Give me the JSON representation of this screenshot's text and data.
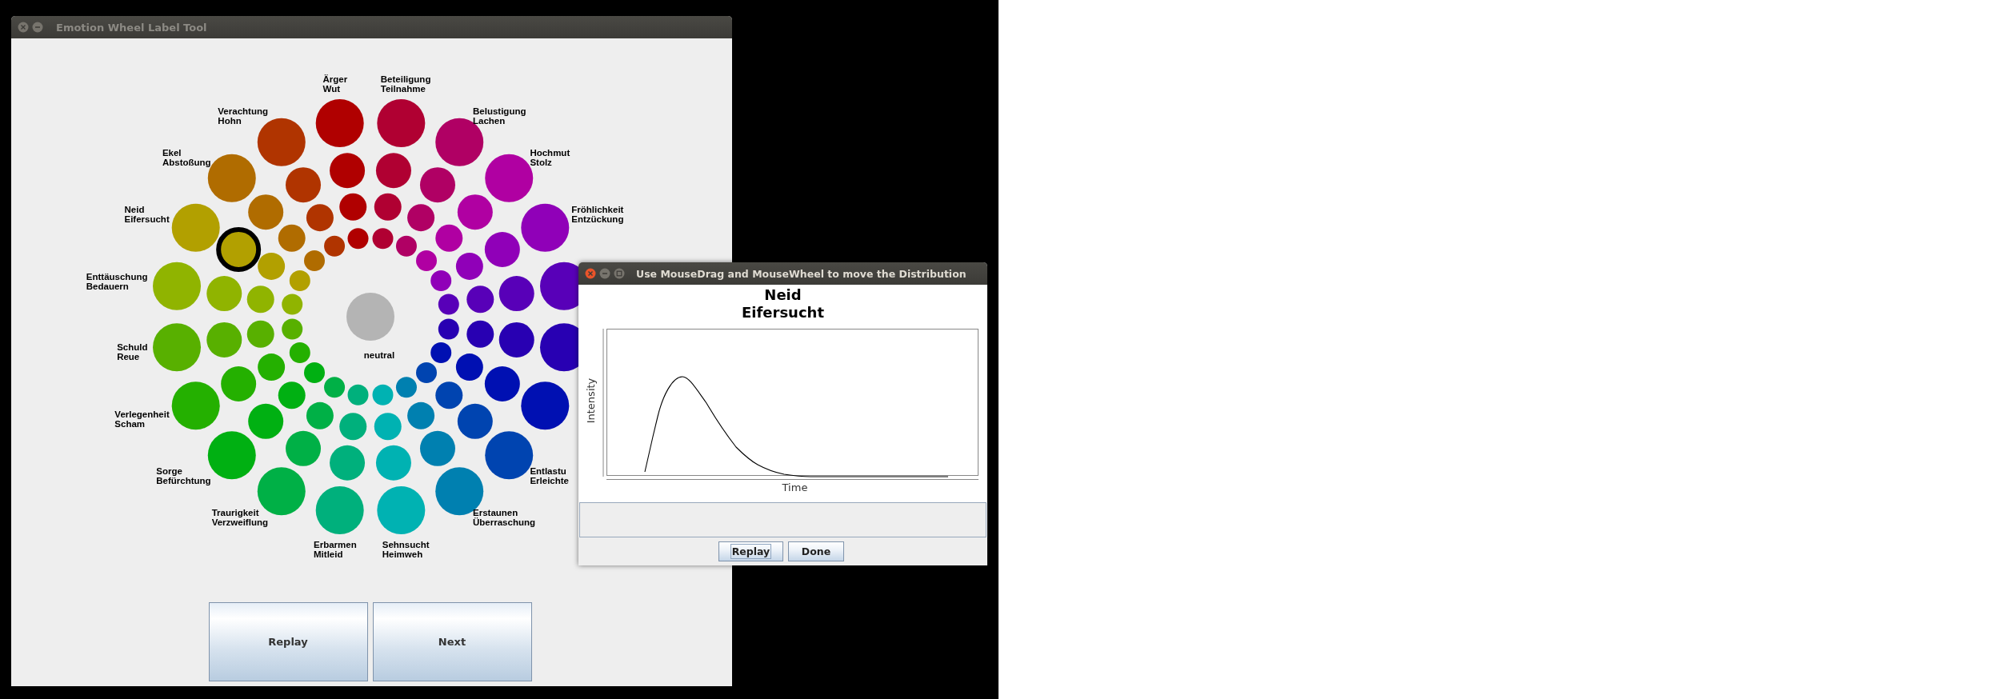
{
  "window": {
    "title": "Emotion Wheel Label Tool",
    "active": false
  },
  "wheel": {
    "center_label": "neutral",
    "upper_spokes": [
      {
        "label": "Enttäuschung\nBedauern",
        "color": "#90b400",
        "circles": [
          {
            "selected": false
          },
          {
            "selected": false
          },
          {
            "selected": false
          },
          {
            "selected": false
          }
        ]
      },
      {
        "label": "Neid\nEifersucht",
        "color": "#b2a000",
        "circles": [
          {
            "selected": false
          },
          {
            "selected": false
          },
          {
            "selected": true
          },
          {
            "selected": false
          }
        ]
      },
      {
        "label": "Ekel\nAbstoßung",
        "color": "#b06c00",
        "circles": [
          {
            "selected": false
          },
          {
            "selected": false
          },
          {
            "selected": false
          },
          {
            "selected": false
          }
        ]
      },
      {
        "label": "Verachtung\nHohn",
        "color": "#b03400",
        "circles": [
          {
            "selected": false
          },
          {
            "selected": false
          },
          {
            "selected": false
          },
          {
            "selected": false
          }
        ]
      },
      {
        "label": "Ärger\nWut",
        "color": "#b00000",
        "circles": [
          {
            "selected": false
          },
          {
            "selected": false
          },
          {
            "selected": false
          },
          {
            "selected": false
          }
        ]
      },
      {
        "label": "Beteiligung\nTeilnahme",
        "color": "#b00032",
        "circles": [
          {
            "selected": false
          },
          {
            "selected": false
          },
          {
            "selected": false
          },
          {
            "selected": false
          }
        ]
      },
      {
        "label": "Belustigung\nLachen",
        "color": "#b00064",
        "circles": [
          {
            "selected": false
          },
          {
            "selected": false
          },
          {
            "selected": false
          },
          {
            "selected": false
          }
        ]
      },
      {
        "label": "Hochmut\nStolz",
        "color": "#b000a2",
        "circles": [
          {
            "selected": false
          },
          {
            "selected": false
          },
          {
            "selected": false
          },
          {
            "selected": false
          }
        ]
      },
      {
        "label": "Fröhlichkeit\nEntzückung",
        "color": "#9000b8",
        "circles": [
          {
            "selected": false
          },
          {
            "selected": false
          },
          {
            "selected": false
          },
          {
            "selected": false
          }
        ]
      },
      {
        "color": "#5800b8",
        "circles": [
          {
            "selected": false
          },
          {
            "selected": false
          },
          {
            "selected": false
          },
          {
            "selected": false
          }
        ]
      }
    ],
    "lower_spokes": [
      {
        "label": "Schuld\nReue",
        "color": "#58b000",
        "circles": [
          {
            "selected": false
          },
          {
            "selected": false
          },
          {
            "selected": false
          },
          {
            "selected": false
          }
        ]
      },
      {
        "label": "Verlegenheit\nScham",
        "color": "#24b000",
        "circles": [
          {
            "selected": false
          },
          {
            "selected": false
          },
          {
            "selected": false
          },
          {
            "selected": false
          }
        ]
      },
      {
        "label": "Sorge\nBefürchtung",
        "color": "#00b012",
        "circles": [
          {
            "selected": false
          },
          {
            "selected": false
          },
          {
            "selected": false
          },
          {
            "selected": false
          }
        ]
      },
      {
        "label": "Traurigkeit\nVerzweiflung",
        "color": "#00b046",
        "circles": [
          {
            "selected": false
          },
          {
            "selected": false
          },
          {
            "selected": false
          },
          {
            "selected": false
          }
        ]
      },
      {
        "label": "Erbarmen\nMitleid",
        "color": "#00b07c",
        "circles": [
          {
            "selected": false
          },
          {
            "selected": false
          },
          {
            "selected": false
          },
          {
            "selected": false
          }
        ]
      },
      {
        "label": "Sehnsucht\nHeimweh",
        "color": "#00b2b2",
        "circles": [
          {
            "selected": false
          },
          {
            "selected": false
          },
          {
            "selected": false
          },
          {
            "selected": false
          }
        ]
      },
      {
        "label": "Erstaunen\nÜberraschung",
        "color": "#0080b0",
        "circles": [
          {
            "selected": false
          },
          {
            "selected": false
          },
          {
            "selected": false
          },
          {
            "selected": false
          }
        ]
      },
      {
        "label": "Entlastu\nErleichte",
        "color": "#0044b0",
        "circles": [
          {
            "selected": false
          },
          {
            "selected": false
          },
          {
            "selected": false
          },
          {
            "selected": false
          }
        ]
      },
      {
        "color": "#0010b2",
        "circles": [
          {
            "selected": false
          },
          {
            "selected": false
          },
          {
            "selected": false
          },
          {
            "selected": false
          }
        ]
      },
      {
        "color": "#2800b2",
        "circles": [
          {
            "selected": false
          },
          {
            "selected": false
          },
          {
            "selected": false
          },
          {
            "selected": false
          }
        ]
      }
    ]
  },
  "buttons": [
    {
      "label": "Replay",
      "focused": false
    },
    {
      "label": "Next",
      "focused": false
    }
  ],
  "dialog": {
    "title": "Use MouseDrag and MouseWheel to move the Distribution",
    "active": true,
    "heading": "Neid\nEifersucht",
    "y_label": "Intensity",
    "x_label": "Time",
    "buttons": [
      {
        "label": "Replay",
        "focused": true
      },
      {
        "label": "Done",
        "focused": false
      }
    ]
  }
}
